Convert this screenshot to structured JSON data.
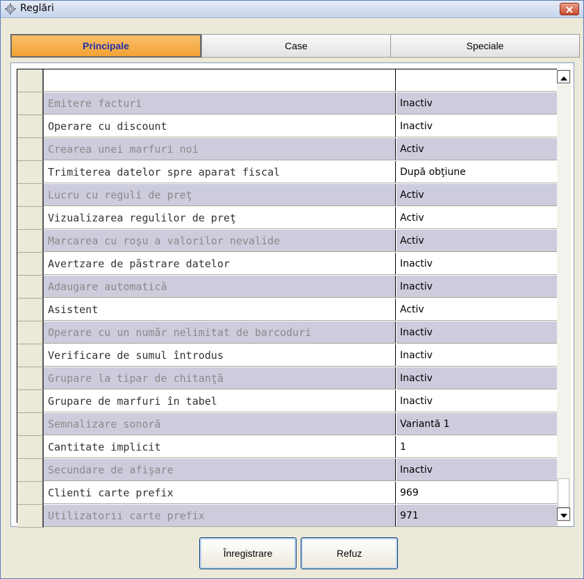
{
  "window": {
    "title": "Reglări",
    "icon": "gear-icon",
    "close_icon": "close-icon"
  },
  "tabs": [
    {
      "label": "Principale",
      "active": true
    },
    {
      "label": "Case",
      "active": false
    },
    {
      "label": "Speciale",
      "active": false
    }
  ],
  "grid": {
    "header": {
      "name": "",
      "value": ""
    },
    "rows": [
      {
        "name": "Emitere facturi",
        "value": "Inactiv"
      },
      {
        "name": "Operare cu discount",
        "value": "Inactiv"
      },
      {
        "name": "Crearea unei marfuri noi",
        "value": "Activ"
      },
      {
        "name": "Trimiterea datelor spre aparat fiscal",
        "value": "După obţiune"
      },
      {
        "name": "Lucru cu reguli de preţ",
        "value": "Activ"
      },
      {
        "name": "Vizualizarea regulilor de preţ",
        "value": "Activ"
      },
      {
        "name": "Marcarea cu roşu a valorilor nevalide",
        "value": "Activ"
      },
      {
        "name": "Avertzare de păstrare datelor",
        "value": "Inactiv"
      },
      {
        "name": "Adaugare automatică",
        "value": "Inactiv"
      },
      {
        "name": "Asistent",
        "value": "Activ"
      },
      {
        "name": "Operare cu un număr nelimitat de barcoduri",
        "value": "Inactiv"
      },
      {
        "name": "Verificare de sumul întrodus",
        "value": "Inactiv"
      },
      {
        "name": "Grupare la tipar de chitanţă",
        "value": "Inactiv"
      },
      {
        "name": "Grupare de marfuri în tabel",
        "value": "Inactiv"
      },
      {
        "name": "Semnalizare sonoră",
        "value": "Variantă 1"
      },
      {
        "name": "Cantitate implicit",
        "value": "1"
      },
      {
        "name": "Secundare de afişare",
        "value": "Inactiv"
      },
      {
        "name": "Clienti carte prefix",
        "value": "969"
      },
      {
        "name": "Utilizatorii carte prefix",
        "value": "971"
      }
    ]
  },
  "buttons": {
    "save": "Înregistrare",
    "cancel": "Refuz"
  },
  "colors": {
    "active_tab": "#f2a233",
    "active_tab_text": "#2330a8",
    "shaded_row": "#ccccdd"
  }
}
